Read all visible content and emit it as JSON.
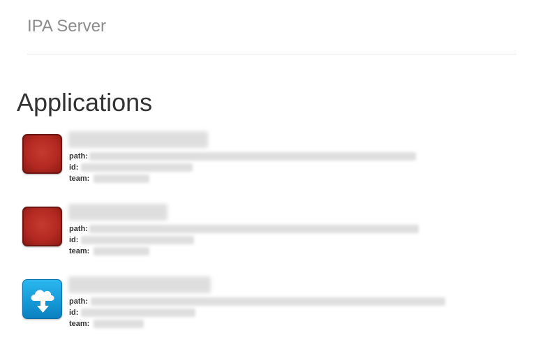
{
  "header": {
    "site_title": "IPA Server"
  },
  "main": {
    "page_title": "Applications",
    "field_labels": {
      "path": "path:",
      "id": "id:",
      "team": "team:"
    },
    "applications": [
      {
        "icon": "red-app-icon"
      },
      {
        "icon": "red-app-icon"
      },
      {
        "icon": "cloud-download-icon"
      }
    ]
  },
  "colors": {
    "site_title": "#8c8c8c",
    "page_title": "#333333",
    "divider": "#e6e6e6",
    "icon_red": "#b42a22",
    "icon_blue": "#1597d6"
  }
}
